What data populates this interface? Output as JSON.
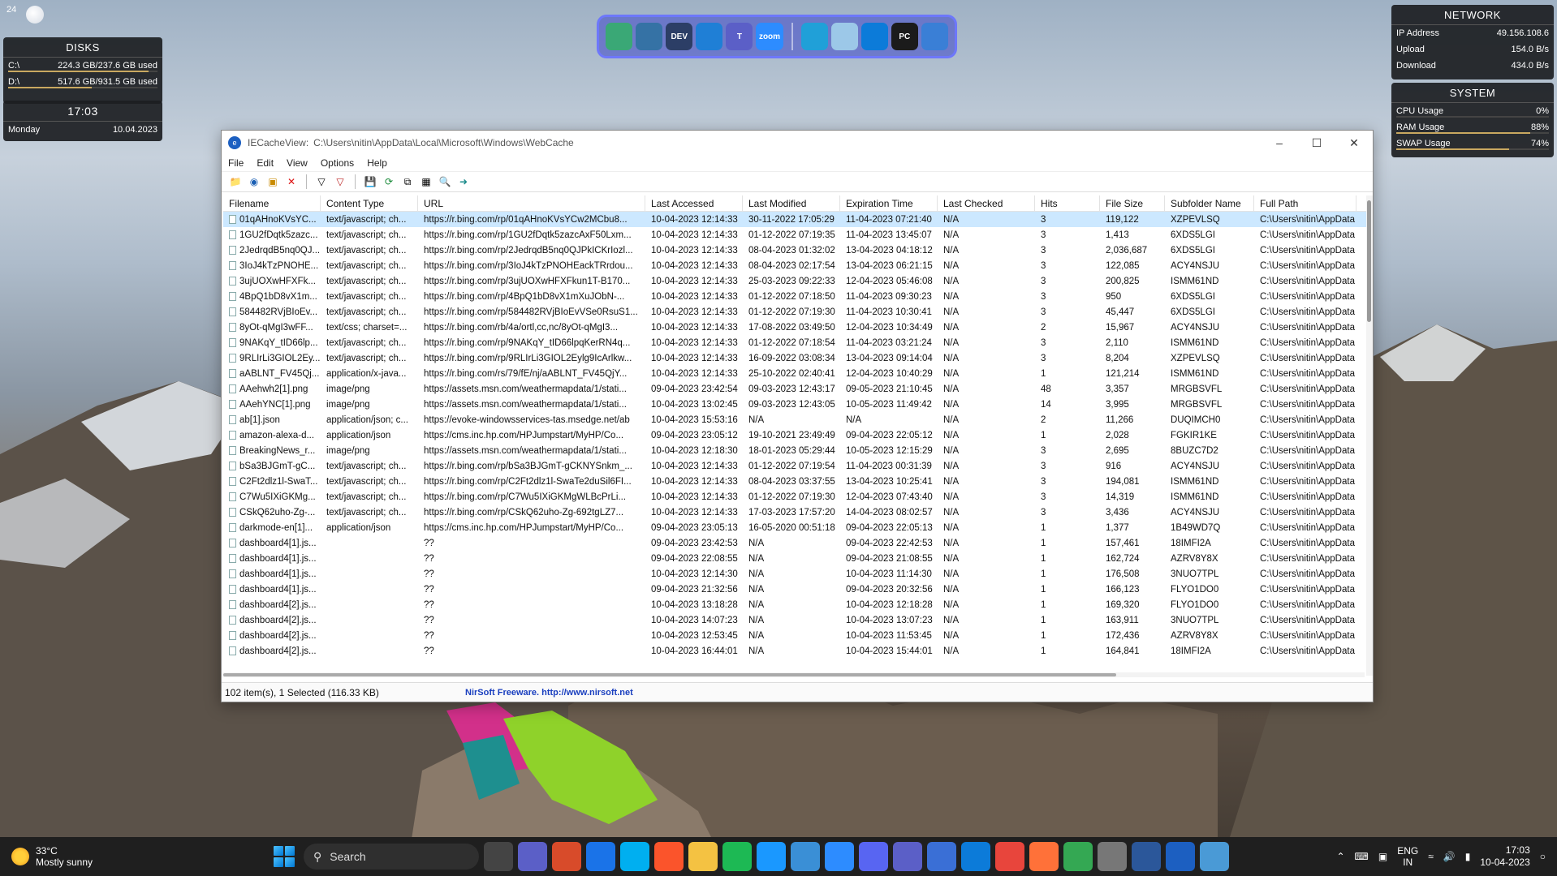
{
  "desktop": {
    "corner_number": "24"
  },
  "widgets": {
    "disks": {
      "title": "DISKS",
      "rows": [
        {
          "label": "C:\\",
          "value": "224.3 GB/237.6 GB used"
        },
        {
          "label": "D:\\",
          "value": "517.6 GB/931.5 GB used"
        }
      ],
      "time": "17:03",
      "day": "Monday",
      "date": "10.04.2023"
    },
    "network": {
      "title": "NETWORK",
      "rows": [
        {
          "label": "IP Address",
          "value": "49.156.108.6"
        },
        {
          "label": "Upload",
          "value": "154.0 B/s"
        },
        {
          "label": "Download",
          "value": "434.0 B/s"
        }
      ]
    },
    "system": {
      "title": "SYSTEM",
      "rows": [
        {
          "label": "CPU Usage",
          "value": "0%",
          "fill": 0.0
        },
        {
          "label": "RAM Usage",
          "value": "88%",
          "fill": 0.88
        },
        {
          "label": "SWAP Usage",
          "value": "74%",
          "fill": 0.74
        }
      ]
    }
  },
  "dock": {
    "icons": [
      {
        "name": "atom-icon",
        "label": "",
        "color": "#3aa876"
      },
      {
        "name": "python-icon",
        "label": "",
        "color": "#3572A5"
      },
      {
        "name": "devcpp-icon",
        "label": "DEV",
        "color": "#2c3e66"
      },
      {
        "name": "vscode-icon",
        "label": "",
        "color": "#1f7fd6"
      },
      {
        "name": "teams-icon",
        "label": "T",
        "color": "#5b5fc7"
      },
      {
        "name": "zoom-icon",
        "label": "zoom",
        "color": "#2d8cff"
      },
      {
        "name": "monitor-icon",
        "label": "",
        "color": "#20a0d8"
      },
      {
        "name": "recycle-bin-icon",
        "label": "",
        "color": "#9cc8e8"
      },
      {
        "name": "edge-icon",
        "label": "",
        "color": "#0c7bd9"
      },
      {
        "name": "pycharm-icon",
        "label": "PC",
        "color": "#1b1b1b"
      },
      {
        "name": "remote-desktop-icon",
        "label": "",
        "color": "#3a7fd6"
      }
    ]
  },
  "window": {
    "app_name": "IECacheView:",
    "path": "C:\\Users\\nitin\\AppData\\Local\\Microsoft\\Windows\\WebCache",
    "menu": [
      "File",
      "Edit",
      "View",
      "Options",
      "Help"
    ],
    "columns": [
      "Filename",
      "Content Type",
      "URL",
      "Last Accessed",
      "Last Modified",
      "Expiration Time",
      "Last Checked",
      "Hits",
      "File Size",
      "Subfolder Name",
      "Full Path"
    ],
    "rows": [
      [
        "01qAHnoKVsYC...",
        "text/javascript; ch...",
        "https://r.bing.com/rp/01qAHnoKVsYCw2MCbu8...",
        "10-04-2023 12:14:33",
        "30-11-2022 17:05:29",
        "11-04-2023 07:21:40",
        "N/A",
        "3",
        "119,122",
        "XZPEVLSQ",
        "C:\\Users\\nitin\\AppData"
      ],
      [
        "1GU2fDqtk5zazc...",
        "text/javascript; ch...",
        "https://r.bing.com/rp/1GU2fDqtk5zazcAxF50Lxm...",
        "10-04-2023 12:14:33",
        "01-12-2022 07:19:35",
        "11-04-2023 13:45:07",
        "N/A",
        "3",
        "1,413",
        "6XDS5LGI",
        "C:\\Users\\nitin\\AppData"
      ],
      [
        "2JedrqdB5nq0QJ...",
        "text/javascript; ch...",
        "https://r.bing.com/rp/2JedrqdB5nq0QJPkICKrIozl...",
        "10-04-2023 12:14:33",
        "08-04-2023 01:32:02",
        "13-04-2023 04:18:12",
        "N/A",
        "3",
        "2,036,687",
        "6XDS5LGI",
        "C:\\Users\\nitin\\AppData"
      ],
      [
        "3IoJ4kTzPNOHE...",
        "text/javascript; ch...",
        "https://r.bing.com/rp/3IoJ4kTzPNOHEackTRrdou...",
        "10-04-2023 12:14:33",
        "08-04-2023 02:17:54",
        "13-04-2023 06:21:15",
        "N/A",
        "3",
        "122,085",
        "ACY4NSJU",
        "C:\\Users\\nitin\\AppData"
      ],
      [
        "3ujUOXwHFXFk...",
        "text/javascript; ch...",
        "https://r.bing.com/rp/3ujUOXwHFXFkun1T-B170...",
        "10-04-2023 12:14:33",
        "25-03-2023 09:22:33",
        "12-04-2023 05:46:08",
        "N/A",
        "3",
        "200,825",
        "ISMM61ND",
        "C:\\Users\\nitin\\AppData"
      ],
      [
        "4BpQ1bD8vX1m...",
        "text/javascript; ch...",
        "https://r.bing.com/rp/4BpQ1bD8vX1mXuJObN-...",
        "10-04-2023 12:14:33",
        "01-12-2022 07:18:50",
        "11-04-2023 09:30:23",
        "N/A",
        "3",
        "950",
        "6XDS5LGI",
        "C:\\Users\\nitin\\AppData"
      ],
      [
        "584482RVjBIoEv...",
        "text/javascript; ch...",
        "https://r.bing.com/rp/584482RVjBIoEvVSe0RsuS1...",
        "10-04-2023 12:14:33",
        "01-12-2022 07:19:30",
        "11-04-2023 10:30:41",
        "N/A",
        "3",
        "45,447",
        "6XDS5LGI",
        "C:\\Users\\nitin\\AppData"
      ],
      [
        "8yOt-qMgI3wFF...",
        "text/css; charset=...",
        "https://r.bing.com/rb/4a/ortl,cc,nc/8yOt-qMgI3...",
        "10-04-2023 12:14:33",
        "17-08-2022 03:49:50",
        "12-04-2023 10:34:49",
        "N/A",
        "2",
        "15,967",
        "ACY4NSJU",
        "C:\\Users\\nitin\\AppData"
      ],
      [
        "9NAKqY_tID66lp...",
        "text/javascript; ch...",
        "https://r.bing.com/rp/9NAKqY_tID66lpqKerRN4q...",
        "10-04-2023 12:14:33",
        "01-12-2022 07:18:54",
        "11-04-2023 03:21:24",
        "N/A",
        "3",
        "2,110",
        "ISMM61ND",
        "C:\\Users\\nitin\\AppData"
      ],
      [
        "9RLIrLi3GIOL2Ey...",
        "text/javascript; ch...",
        "https://r.bing.com/rp/9RLIrLi3GIOL2Eylg9IcArlkw...",
        "10-04-2023 12:14:33",
        "16-09-2022 03:08:34",
        "13-04-2023 09:14:04",
        "N/A",
        "3",
        "8,204",
        "XZPEVLSQ",
        "C:\\Users\\nitin\\AppData"
      ],
      [
        "aABLNT_FV45Qj...",
        "application/x-java...",
        "https://r.bing.com/rs/79/fE/nj/aABLNT_FV45QjY...",
        "10-04-2023 12:14:33",
        "25-10-2022 02:40:41",
        "12-04-2023 10:40:29",
        "N/A",
        "1",
        "121,214",
        "ISMM61ND",
        "C:\\Users\\nitin\\AppData"
      ],
      [
        "AAehwh2[1].png",
        "image/png",
        "https://assets.msn.com/weathermapdata/1/stati...",
        "09-04-2023 23:42:54",
        "09-03-2023 12:43:17",
        "09-05-2023 21:10:45",
        "N/A",
        "48",
        "3,357",
        "MRGBSVFL",
        "C:\\Users\\nitin\\AppData"
      ],
      [
        "AAehYNC[1].png",
        "image/png",
        "https://assets.msn.com/weathermapdata/1/stati...",
        "10-04-2023 13:02:45",
        "09-03-2023 12:43:05",
        "10-05-2023 11:49:42",
        "N/A",
        "14",
        "3,995",
        "MRGBSVFL",
        "C:\\Users\\nitin\\AppData"
      ],
      [
        "ab[1].json",
        "application/json; c...",
        "https://evoke-windowsservices-tas.msedge.net/ab",
        "10-04-2023 15:53:16",
        "N/A",
        "N/A",
        "N/A",
        "2",
        "11,266",
        "DUQIMCH0",
        "C:\\Users\\nitin\\AppData"
      ],
      [
        "amazon-alexa-d...",
        "application/json",
        "https://cms.inc.hp.com/HPJumpstart/MyHP/Co...",
        "09-04-2023 23:05:12",
        "19-10-2021 23:49:49",
        "09-04-2023 22:05:12",
        "N/A",
        "1",
        "2,028",
        "FGKIR1KE",
        "C:\\Users\\nitin\\AppData"
      ],
      [
        "BreakingNews_r...",
        "image/png",
        "https://assets.msn.com/weathermapdata/1/stati...",
        "10-04-2023 12:18:30",
        "18-01-2023 05:29:44",
        "10-05-2023 12:15:29",
        "N/A",
        "3",
        "2,695",
        "8BUZC7D2",
        "C:\\Users\\nitin\\AppData"
      ],
      [
        "bSa3BJGmT-gC...",
        "text/javascript; ch...",
        "https://r.bing.com/rp/bSa3BJGmT-gCKNYSnkm_...",
        "10-04-2023 12:14:33",
        "01-12-2022 07:19:54",
        "11-04-2023 00:31:39",
        "N/A",
        "3",
        "916",
        "ACY4NSJU",
        "C:\\Users\\nitin\\AppData"
      ],
      [
        "C2Ft2dlz1l-SwaT...",
        "text/javascript; ch...",
        "https://r.bing.com/rp/C2Ft2dlz1l-SwaTe2duSil6FI...",
        "10-04-2023 12:14:33",
        "08-04-2023 03:37:55",
        "13-04-2023 10:25:41",
        "N/A",
        "3",
        "194,081",
        "ISMM61ND",
        "C:\\Users\\nitin\\AppData"
      ],
      [
        "C7Wu5IXiGKMg...",
        "text/javascript; ch...",
        "https://r.bing.com/rp/C7Wu5IXiGKMgWLBcPrLi...",
        "10-04-2023 12:14:33",
        "01-12-2022 07:19:30",
        "12-04-2023 07:43:40",
        "N/A",
        "3",
        "14,319",
        "ISMM61ND",
        "C:\\Users\\nitin\\AppData"
      ],
      [
        "CSkQ62uho-Zg-...",
        "text/javascript; ch...",
        "https://r.bing.com/rp/CSkQ62uho-Zg-692tgLZ7...",
        "10-04-2023 12:14:33",
        "17-03-2023 17:57:20",
        "14-04-2023 08:02:57",
        "N/A",
        "3",
        "3,436",
        "ACY4NSJU",
        "C:\\Users\\nitin\\AppData"
      ],
      [
        "darkmode-en[1]...",
        "application/json",
        "https://cms.inc.hp.com/HPJumpstart/MyHP/Co...",
        "09-04-2023 23:05:13",
        "16-05-2020 00:51:18",
        "09-04-2023 22:05:13",
        "N/A",
        "1",
        "1,377",
        "1B49WD7Q",
        "C:\\Users\\nitin\\AppData"
      ],
      [
        "dashboard4[1].js...",
        "",
        "??",
        "09-04-2023 23:42:53",
        "N/A",
        "09-04-2023 22:42:53",
        "N/A",
        "1",
        "157,461",
        "18IMFI2A",
        "C:\\Users\\nitin\\AppData"
      ],
      [
        "dashboard4[1].js...",
        "",
        "??",
        "09-04-2023 22:08:55",
        "N/A",
        "09-04-2023 21:08:55",
        "N/A",
        "1",
        "162,724",
        "AZRV8Y8X",
        "C:\\Users\\nitin\\AppData"
      ],
      [
        "dashboard4[1].js...",
        "",
        "??",
        "10-04-2023 12:14:30",
        "N/A",
        "10-04-2023 11:14:30",
        "N/A",
        "1",
        "176,508",
        "3NUO7TPL",
        "C:\\Users\\nitin\\AppData"
      ],
      [
        "dashboard4[1].js...",
        "",
        "??",
        "09-04-2023 21:32:56",
        "N/A",
        "09-04-2023 20:32:56",
        "N/A",
        "1",
        "166,123",
        "FLYO1DO0",
        "C:\\Users\\nitin\\AppData"
      ],
      [
        "dashboard4[2].js...",
        "",
        "??",
        "10-04-2023 13:18:28",
        "N/A",
        "10-04-2023 12:18:28",
        "N/A",
        "1",
        "169,320",
        "FLYO1DO0",
        "C:\\Users\\nitin\\AppData"
      ],
      [
        "dashboard4[2].js...",
        "",
        "??",
        "10-04-2023 14:07:23",
        "N/A",
        "10-04-2023 13:07:23",
        "N/A",
        "1",
        "163,911",
        "3NUO7TPL",
        "C:\\Users\\nitin\\AppData"
      ],
      [
        "dashboard4[2].js...",
        "",
        "??",
        "10-04-2023 12:53:45",
        "N/A",
        "10-04-2023 11:53:45",
        "N/A",
        "1",
        "172,436",
        "AZRV8Y8X",
        "C:\\Users\\nitin\\AppData"
      ],
      [
        "dashboard4[2].js...",
        "",
        "??",
        "10-04-2023 16:44:01",
        "N/A",
        "10-04-2023 15:44:01",
        "N/A",
        "1",
        "164,841",
        "18IMFI2A",
        "C:\\Users\\nitin\\AppData"
      ]
    ],
    "status": {
      "count": "102 item(s), 1 Selected  (116.33 KB)",
      "credit": "NirSoft Freeware.  http://www.nirsoft.net"
    }
  },
  "taskbar": {
    "weather_temp": "33°C",
    "weather_desc": "Mostly sunny",
    "search_placeholder": "Search",
    "apps": [
      {
        "name": "task-view-icon",
        "color": "#444"
      },
      {
        "name": "camera-icon",
        "color": "#5b5fc7"
      },
      {
        "name": "photos-icon",
        "color": "#d84b2a"
      },
      {
        "name": "mail-icon",
        "color": "#1a73e8"
      },
      {
        "name": "skype-icon",
        "color": "#00aff0"
      },
      {
        "name": "brave-icon",
        "color": "#fb542b"
      },
      {
        "name": "file-explorer-icon",
        "color": "#f4c242"
      },
      {
        "name": "spotify-icon",
        "color": "#1db954"
      },
      {
        "name": "prime-video-icon",
        "color": "#1a98ff"
      },
      {
        "name": "notepad-icon",
        "color": "#3a8fd6"
      },
      {
        "name": "zoom-taskbar-icon",
        "color": "#2d8cff"
      },
      {
        "name": "discord-icon",
        "color": "#5865f2"
      },
      {
        "name": "teams-taskbar-icon",
        "color": "#5b5fc7"
      },
      {
        "name": "store-icon",
        "color": "#3a6fd6"
      },
      {
        "name": "edge-taskbar-icon",
        "color": "#0c7bd9"
      },
      {
        "name": "chrome-icon",
        "color": "#e8453c"
      },
      {
        "name": "firefox-icon",
        "color": "#ff7139"
      },
      {
        "name": "chrome-profile-icon",
        "color": "#34a853"
      },
      {
        "name": "settings-icon",
        "color": "#777"
      },
      {
        "name": "word-icon",
        "color": "#2b579a"
      },
      {
        "name": "iecacheview-taskbar-icon",
        "color": "#1c5fc1"
      },
      {
        "name": "snipping-tool-icon",
        "color": "#4a9ad6"
      }
    ],
    "lang_top": "ENG",
    "lang_bottom": "IN",
    "time": "17:03",
    "date": "10-04-2023"
  }
}
